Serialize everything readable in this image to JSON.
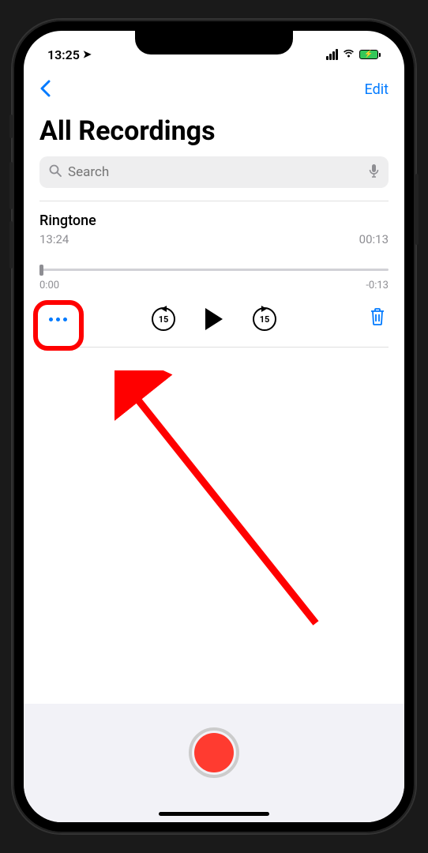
{
  "status": {
    "time": "13:25",
    "location_active": true
  },
  "nav": {
    "edit_label": "Edit"
  },
  "title": "All Recordings",
  "search": {
    "placeholder": "Search"
  },
  "recording": {
    "name": "Ringtone",
    "time": "13:24",
    "duration": "00:13",
    "elapsed": "0:00",
    "remaining": "-0:13",
    "skip_seconds": "15"
  }
}
